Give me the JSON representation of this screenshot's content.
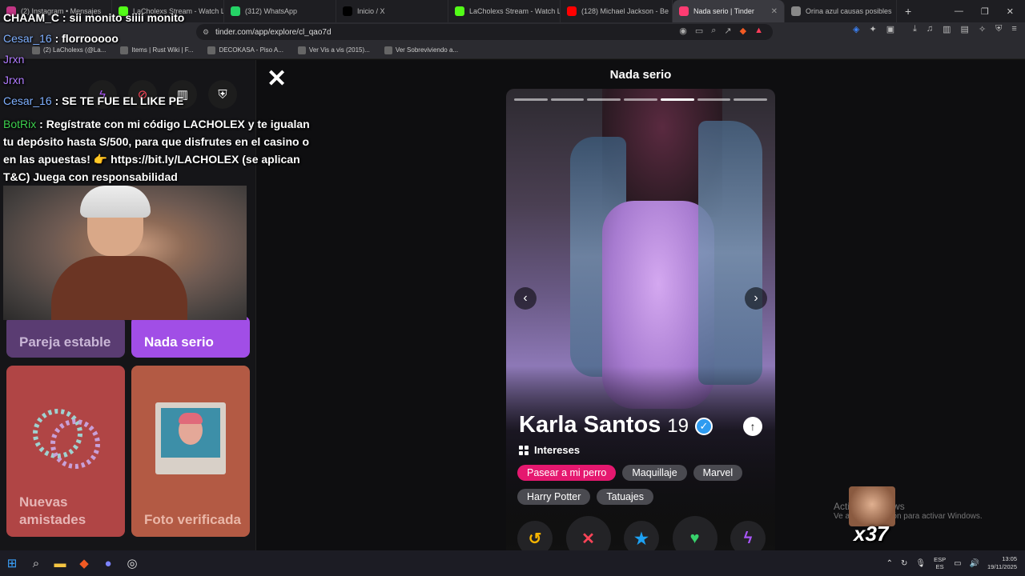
{
  "browser": {
    "tabs": [
      {
        "title": "(2) Instagram • Mensajes",
        "color": "#c13584"
      },
      {
        "title": "LaCholexs Stream - Watch Live",
        "color": "#53fc18"
      },
      {
        "title": "(312) WhatsApp",
        "color": "#25d366"
      },
      {
        "title": "Inicio / X",
        "color": "#000000"
      },
      {
        "title": "LaCholexs Stream - Watch Live",
        "color": "#53fc18"
      },
      {
        "title": "(128) Michael Jackson - Be",
        "color": "#ff0000"
      },
      {
        "title": "Nada serio | Tinder",
        "color": "#fe3c72",
        "active": true
      },
      {
        "title": "Orina azul causas posibles",
        "color": "#888888"
      }
    ],
    "url": "tinder.com/app/explore/cl_qao7d",
    "bookmarks": [
      "(2) LaCholexs (@La...",
      "Items | Rust Wiki | F...",
      "DECOKASA - Piso A...",
      "Ver Vis a vis (2015)...",
      "Ver Sobreviviendo a..."
    ]
  },
  "tinder": {
    "page_title": "Nada serio",
    "categories": [
      {
        "label": "Pareja estable"
      },
      {
        "label": "Nada serio"
      },
      {
        "label": "Nuevas amistades"
      },
      {
        "label": "Foto verificada"
      }
    ],
    "photo_count": 7,
    "photo_active": 5,
    "profile": {
      "name": "Karla Santos",
      "age": "19",
      "interests_heading": "Intereses",
      "interests": [
        {
          "label": "Pasear a mi perro",
          "match": true
        },
        {
          "label": "Maquillaje",
          "match": false
        },
        {
          "label": "Marvel",
          "match": false
        },
        {
          "label": "Harry Potter",
          "match": false
        },
        {
          "label": "Tatuajes",
          "match": false
        }
      ]
    },
    "actions": [
      {
        "icon": "rewind-icon",
        "glyph": "↺",
        "color": "#f7b500"
      },
      {
        "icon": "nope-icon",
        "glyph": "✕",
        "color": "#ff4458"
      },
      {
        "icon": "super-like-icon",
        "glyph": "★",
        "color": "#1da1f2"
      },
      {
        "icon": "like-icon",
        "glyph": "♥",
        "color": "#38d26c"
      },
      {
        "icon": "boost-icon",
        "glyph": "ϟ",
        "color": "#a855f7"
      }
    ]
  },
  "stream_overlay": {
    "chat": [
      {
        "user": "CHAAM_C",
        "text": " : sii monito siiii monito",
        "color": "white"
      },
      {
        "user": "Cesar_16",
        "text": " : florrooooo",
        "color": "blue"
      },
      {
        "user": "Jrxn",
        "text": "",
        "color": "purple"
      },
      {
        "user": "Jrxn",
        "text": "",
        "color": "purple"
      },
      {
        "user": "Cesar_16",
        "text": " : SE TE FUE EL LIKE PE",
        "color": "blue"
      }
    ],
    "bot": {
      "user": "BotRix",
      "text": "Regístrate con mi código LACHOLEX y te igualan tu depósito hasta S/500, para que disfrutes en el casino o en las apuestas! 👉 https://bit.ly/LACHOLEX (se aplican T&C) Juega con responsabilidad"
    },
    "emote_count": "x37"
  },
  "windows": {
    "watermark_title": "Activar Windows",
    "watermark_sub": "Ve a Configuración para activar Windows.",
    "lang_top": "ESP",
    "lang_bottom": "ES",
    "time": "13:05",
    "date": "19/11/2025"
  }
}
